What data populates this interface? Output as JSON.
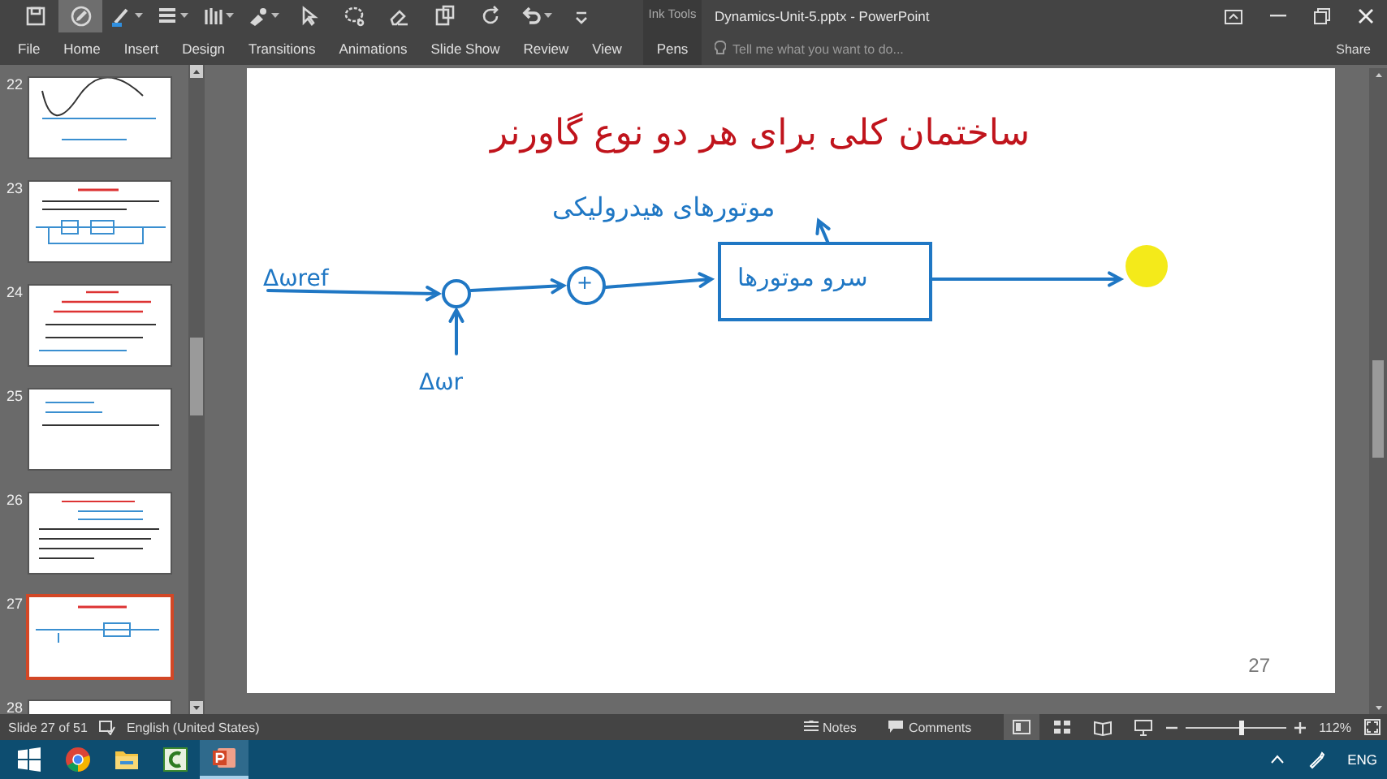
{
  "window": {
    "title": "Dynamics-Unit-5.pptx - PowerPoint"
  },
  "quick_access": [
    {
      "on": false
    },
    {
      "on": true
    },
    {
      "on": false
    },
    {
      "on": false
    },
    {
      "on": false
    },
    {
      "on": false
    },
    {
      "on": false
    },
    {
      "on": false
    },
    {
      "on": false
    },
    {
      "on": false
    },
    {
      "on": false
    },
    {
      "on": false
    },
    {
      "on": false
    }
  ],
  "ribbon": {
    "tabs": [
      {
        "label": "File",
        "selected": false
      },
      {
        "label": "Home",
        "selected": false
      },
      {
        "label": "Insert",
        "selected": false
      },
      {
        "label": "Design",
        "selected": false
      },
      {
        "label": "Transitions",
        "selected": false
      },
      {
        "label": "Animations",
        "selected": false
      },
      {
        "label": "Slide Show",
        "selected": false
      },
      {
        "label": "Review",
        "selected": false
      },
      {
        "label": "View",
        "selected": false
      }
    ],
    "contextual_group": {
      "label": "Ink Tools",
      "tabs": [
        {
          "label": "Pens",
          "selected": false
        }
      ]
    },
    "tell_me": {
      "placeholder": "Tell me what you want to do..."
    },
    "share": "Share"
  },
  "thumbnails": [
    {
      "number": "22",
      "selected": false
    },
    {
      "number": "23",
      "selected": false
    },
    {
      "number": "24",
      "selected": false
    },
    {
      "number": "25",
      "selected": false
    },
    {
      "number": "26",
      "selected": false
    },
    {
      "number": "27",
      "selected": true
    },
    {
      "number": "28",
      "selected": false
    }
  ],
  "slide": {
    "title": "ساختمان کلی برای هر دو نوع گاورنر",
    "upper_label": "موتورهای هیدرولیکی",
    "block_label": "سرو موتورها",
    "reference_input": "Δωref",
    "feedback_input": "Δωr",
    "junction_sign": "+",
    "slide_number": "27"
  },
  "status_bar": {
    "slide_info": "Slide 27 of 51",
    "language": "English (United States)",
    "notes": "Notes",
    "comments": "Comments",
    "views": [
      {
        "selected": true
      },
      {
        "selected": false
      },
      {
        "selected": false
      },
      {
        "selected": false
      }
    ],
    "zoom": {
      "level": 0.55,
      "reading": "112%"
    }
  },
  "taskbar": {
    "apps": [
      {
        "kind": "start",
        "active": false
      },
      {
        "kind": "browser",
        "active": false
      },
      {
        "kind": "folder",
        "active": false
      },
      {
        "kind": "recorder",
        "active": false
      },
      {
        "kind": "presentation",
        "active": true
      }
    ],
    "language": "ENG"
  }
}
